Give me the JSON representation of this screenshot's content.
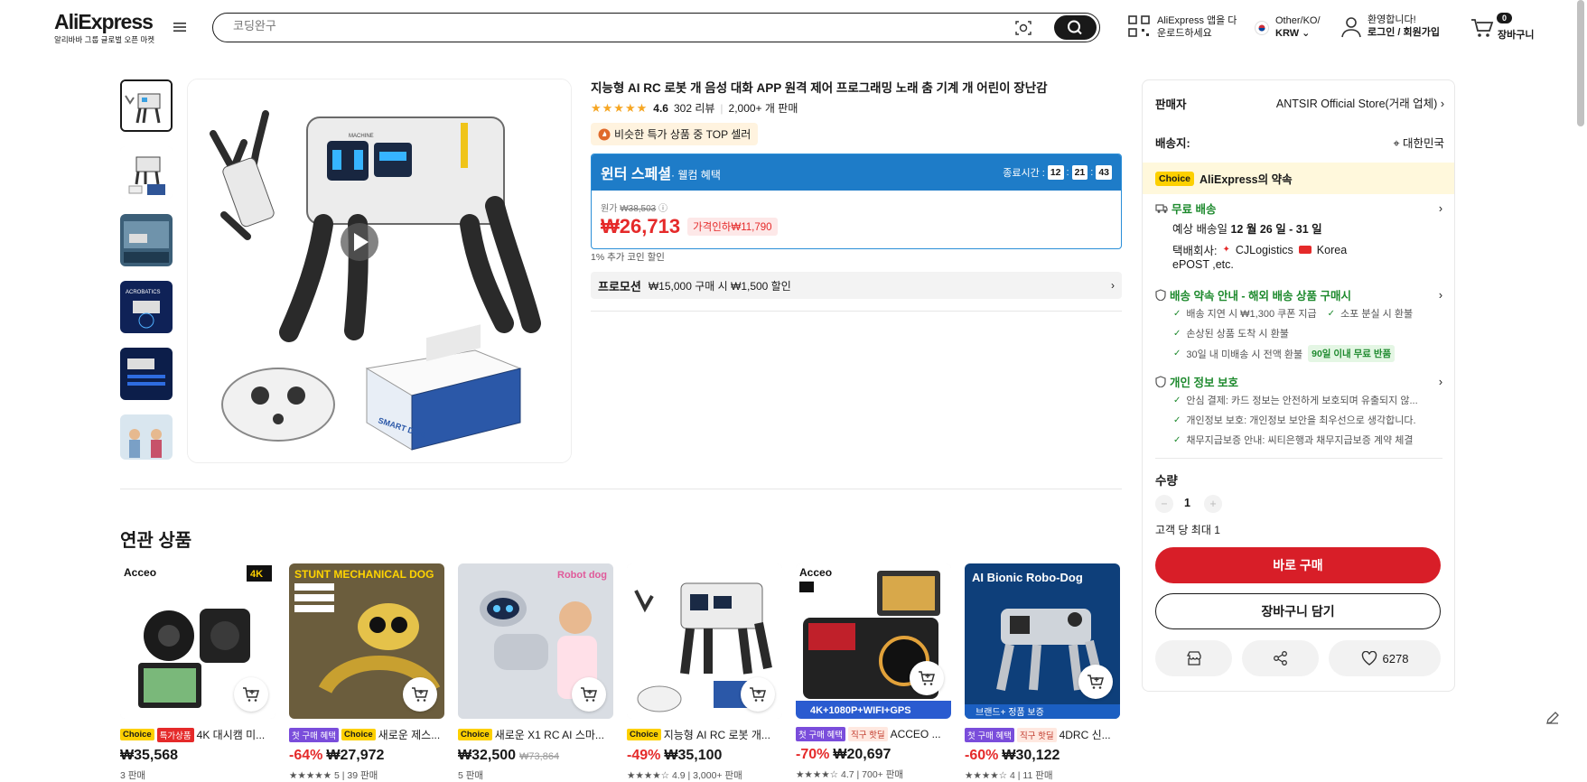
{
  "header": {
    "logo_text": "AliExpress",
    "logo_sub": "알리바바 그룹 글로벌 오픈 마켓",
    "search_placeholder": "코딩완구",
    "app_line1": "AliExpress 앱을 다",
    "app_line2": "운로드하세요",
    "region_line1": "Other/KO/",
    "region_line2": "KRW",
    "account_line1": "환영합니다!",
    "account_line2": "로그인 / 회원가입",
    "cart_count": "0",
    "cart_label": "장바구니"
  },
  "product": {
    "title": "지능형 AI RC 로봇 개 음성 대화 APP 원격 제어 프로그래밍 노래 춤 기계 개 어린이 장난감",
    "rating": "4.6",
    "reviews": "302 리뷰",
    "sold": "2,000+ 개 판매",
    "top_seller": "비슷한 특가 상품 중 TOP 셀러",
    "deal_title": "윈터 스페셜",
    "deal_sub": "· 웰컴 혜택",
    "timer_label": "종료시간 :",
    "timer_h": "12",
    "timer_m": "21",
    "timer_s": "43",
    "orig_label": "원가",
    "orig_price": "₩38,503",
    "price": "₩26,713",
    "discount": "가격인하₩11,790",
    "coin": "1% 추가 코인 할인",
    "promo_label": "프로모션",
    "promo_text": "₩15,000 구매 시 ₩1,500 할인"
  },
  "panel": {
    "seller_label": "판매자",
    "seller_name": "ANTSIR Official Store(거래 업체)",
    "ship_to_label": "배송지:",
    "ship_to": "대한민국",
    "choice_tag": "Choice",
    "choice_text": "AliExpress의 약속",
    "free_ship": "무료 배송",
    "eta_label": "예상 배송일",
    "eta": "12 월 26 일 - 31 일",
    "carrier_label": "택배회사:",
    "carrier1": "CJLogistics",
    "carrier2": "Korea",
    "carrier3": "ePOST ,etc.",
    "promise_title": "배송 약속 안내 - 해외 배송 상품 구매시",
    "promise_items": [
      "배송 지연 시 ₩1,300 쿠폰 지급",
      "소포 분실 시 환불",
      "손상된 상품 도착 시 환불",
      "30일 내 미배송 시 전액 환불"
    ],
    "return_badge": "90일 이내 무료 반품",
    "privacy_title": "개인 정보 보호",
    "privacy_items": [
      "안심 결제: 카드 정보는 안전하게 보호되며 유출되지 않...",
      "개인정보 보호: 개인정보 보안을 최우선으로 생각합니다.",
      "채무지급보증 안내: 씨티은행과 채무지급보증 계약 체결"
    ],
    "qty_label": "수량",
    "qty": "1",
    "limit": "고객 당 최대 1",
    "buy_now": "바로 구매",
    "add_cart": "장바구니 담기",
    "wish_count": "6278"
  },
  "related": {
    "title": "연관 상품",
    "items": [
      {
        "tags": [
          "Choice",
          "특가상품"
        ],
        "name": "4K 대시캠 미...",
        "pct": "",
        "price": "₩35,568",
        "old": "",
        "meta": "3 판매"
      },
      {
        "tags": [
          "첫 구매 혜택",
          "Choice"
        ],
        "name": "새로운 제스...",
        "pct": "-64%",
        "price": "₩27,972",
        "old": "",
        "meta": "★★★★★ 5 | 39 판매"
      },
      {
        "tags": [
          "Choice"
        ],
        "name": "새로운 X1 RC AI 스마...",
        "pct": "",
        "price": "₩32,500",
        "old": "₩73,864",
        "meta": "5 판매"
      },
      {
        "tags": [
          "Choice"
        ],
        "name": "지능형 AI RC 로봇 개...",
        "pct": "-49%",
        "price": "₩35,100",
        "old": "",
        "meta": "★★★★☆ 4.9 | 3,000+ 판매"
      },
      {
        "tags": [
          "첫 구매 혜택",
          "직구 핫딜"
        ],
        "name": "ACCEO ...",
        "pct": "-70%",
        "price": "₩20,697",
        "old": "",
        "meta": "★★★★☆ 4.7 | 700+ 판매"
      },
      {
        "tags": [
          "첫 구매 혜택",
          "직구 핫딜"
        ],
        "name": "4DRC 신...",
        "pct": "-60%",
        "price": "₩30,122",
        "old": "",
        "meta": "★★★★☆ 4 | 11 판매"
      }
    ],
    "img_texts": [
      "Acceo",
      "STUNT MECHANICAL DOG",
      "Robot dog",
      "",
      "Acceo",
      "AI Bionic Robo-Dog"
    ],
    "img_sub": [
      "4K",
      "",
      "",
      "",
      "4K+1080P+WIFI+GPS",
      "브랜드+ 정품 보증"
    ]
  }
}
